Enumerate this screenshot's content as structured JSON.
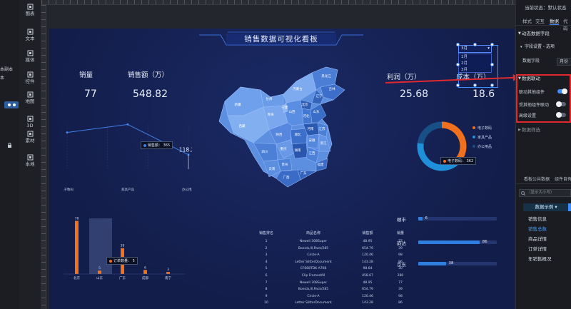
{
  "toolbar": {
    "items": [
      {
        "label": "图表",
        "icon": "chart-icon"
      },
      {
        "label": "文本",
        "icon": "text-icon"
      },
      {
        "label": "媒体",
        "icon": "media-icon"
      },
      {
        "label": "控件",
        "icon": "control-icon"
      },
      {
        "label": "地图",
        "icon": "map-icon"
      },
      {
        "label": "3D",
        "icon": "3d-icon"
      },
      {
        "label": "素材",
        "icon": "asset-icon"
      },
      {
        "label": "本地",
        "icon": "local-icon"
      }
    ]
  },
  "rail": {
    "text1": "本副本",
    "text2": "本"
  },
  "dashboard": {
    "title": "销售数据可视化看板",
    "kpis": [
      {
        "label": "销量",
        "value": "77"
      },
      {
        "label": "销售额（万）",
        "value": "548.82"
      },
      {
        "label": "利润（万）",
        "value": "25.68"
      },
      {
        "label": "成本（万）",
        "value": "18.6"
      }
    ],
    "month_dropdown": {
      "selected": "3月",
      "options": [
        "1月",
        "2月",
        "3月"
      ]
    },
    "map_labels": [
      "新疆",
      "西藏",
      "青海",
      "甘肃",
      "内蒙古",
      "黑龙江",
      "吉林",
      "辽宁",
      "北京",
      "河北",
      "山西",
      "陕西",
      "四川",
      "重庆",
      "云南",
      "贵州",
      "广西",
      "广东",
      "湖南",
      "湖北",
      "河南",
      "山东",
      "江苏",
      "安徽",
      "浙江",
      "江西",
      "福建",
      "宁夏"
    ],
    "line_tooltip": {
      "label": "销售额：",
      "value": "365"
    },
    "bar_tooltip": {
      "label": "订单数量：",
      "value": "5"
    },
    "donut_tooltip": {
      "label": "电子数码：",
      "value": "362"
    },
    "table": {
      "headers": [
        "销售排名",
        "商品名称",
        "销售额",
        "销量"
      ],
      "rows": [
        [
          "1",
          "Newell 308Super",
          "48.95",
          "77"
        ],
        [
          "2",
          "Boeicb,lll,Pack/285",
          "654.79",
          "39"
        ],
        [
          "3",
          "Circle-A",
          "120.46",
          "98"
        ],
        [
          "4",
          "Letter SlitterDocument",
          "143.28",
          "86"
        ],
        [
          "5",
          "CF688TDK A708",
          "98.64",
          "30"
        ],
        [
          "6",
          "Clip FramedAll",
          "458.67",
          "280"
        ],
        [
          "7",
          "Newell 308Super",
          "48.95",
          "77"
        ],
        [
          "8",
          "Boeicb,lll,Pack/285",
          "654.79",
          "39"
        ],
        [
          "9",
          "Circle-A",
          "120.46",
          "98"
        ],
        [
          "10",
          "Letter SlitterDocument",
          "143.28",
          "86"
        ]
      ]
    },
    "hbars": [
      {
        "label": "顺丰",
        "value": "6",
        "frac": 0.05
      },
      {
        "label": "韵达",
        "value": "86",
        "frac": 0.78
      },
      {
        "label": "京东",
        "value": "38",
        "frac": 0.35
      }
    ]
  },
  "chart_data": [
    {
      "type": "line",
      "categories": [
        "电子数码",
        "家具产品",
        "办公用品"
      ],
      "values": [
        300,
        365,
        118.21
      ],
      "data_label": "118.21",
      "ylim": [
        0,
        420
      ],
      "color": "#3f7fe8"
    },
    {
      "type": "bar",
      "categories": [
        "北京",
        "山东",
        "广东",
        "成都",
        "南宁"
      ],
      "values": [
        78,
        5,
        38,
        6,
        3
      ],
      "ylim": [
        0,
        90
      ],
      "color": "#f0701e"
    },
    {
      "type": "pie",
      "donut": true,
      "categories": [
        "电子数码",
        "家具产品",
        "办公用品"
      ],
      "values": [
        362,
        410,
        228
      ],
      "colors": [
        "#f0701e",
        "#1e8fd8",
        "#174f86"
      ],
      "legend": "right"
    }
  ],
  "panel": {
    "status_label": "当前状态：",
    "status_value": "默认状态",
    "tabs": [
      "样式",
      "交互",
      "数据",
      "代码"
    ],
    "sec_dynamic": "动态数据字段",
    "sec_field_option": "字段设置 - 选项",
    "field_label": "数据字段",
    "field_value": "月份",
    "sec_link": "数据联动",
    "toggles": [
      {
        "label": "联动其他组件",
        "on": true
      },
      {
        "label": "受其他组件联动",
        "on": false
      },
      {
        "label": "高级设置",
        "on": false
      }
    ],
    "sec_filter": "数据筛选",
    "bottom_tabs": [
      "看板公共数据",
      "组件自有"
    ],
    "search_placeholder": "（显示大小写）",
    "chip": "数据示例",
    "items": [
      "销售信息",
      "销售总数",
      "商品详情",
      "订单详情",
      "年销售概况"
    ],
    "active_item": 1
  },
  "colors": {
    "accent": "#3f8cff",
    "alert": "#e0292e",
    "board": "#131d4a"
  }
}
